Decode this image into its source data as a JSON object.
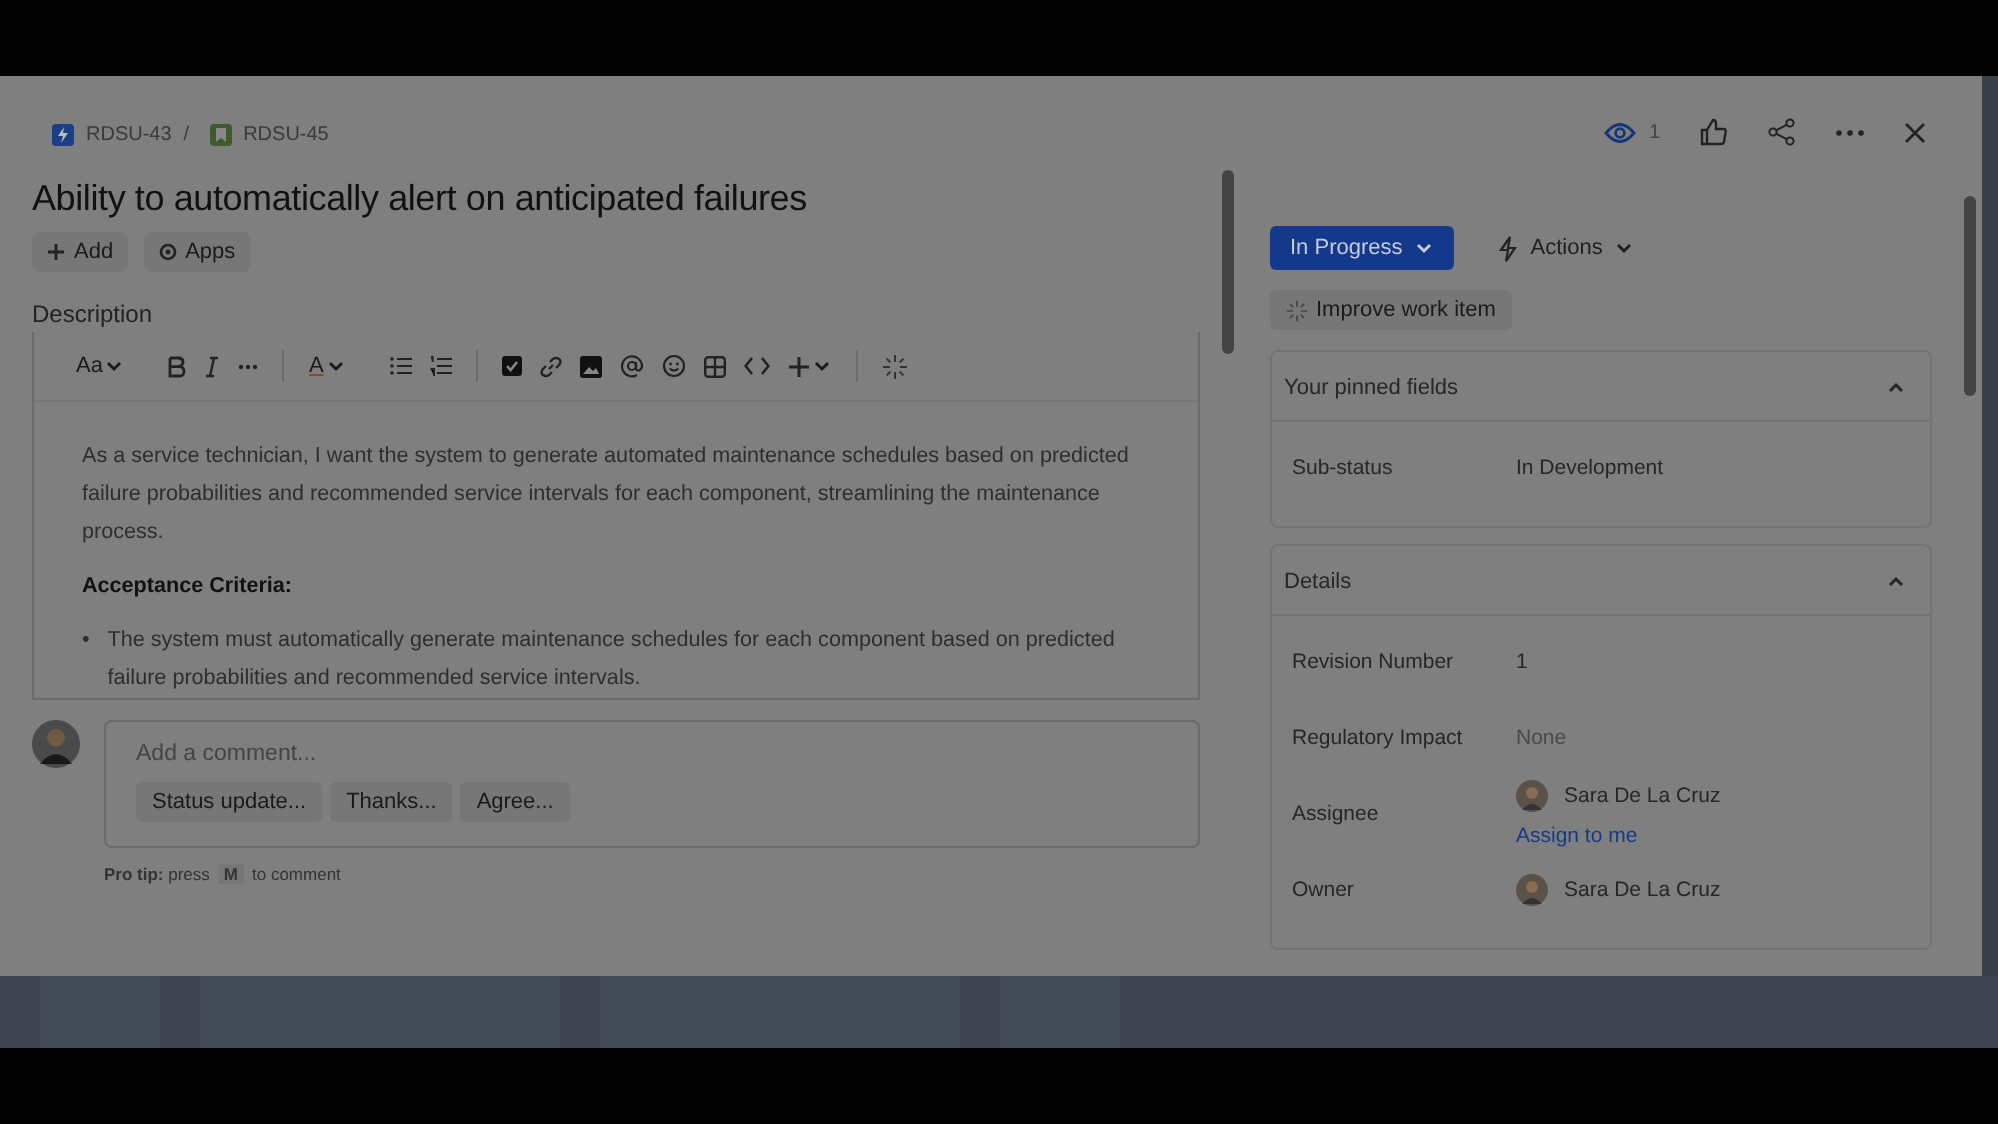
{
  "breadcrumbs": [
    {
      "label": "RDSU-43",
      "kind": "epic"
    },
    {
      "label": "RDSU-45",
      "kind": "story"
    }
  ],
  "breadcrumb_separator": "/",
  "bullet": "•",
  "header": {
    "watchers": "1"
  },
  "title": "Ability to automatically alert on anticipated failures",
  "title_actions": [
    {
      "label": "Add",
      "kind": "add"
    },
    {
      "label": "Apps",
      "kind": "apps"
    }
  ],
  "description": {
    "label": "Description",
    "toolbar": {
      "text_style": "Aa",
      "font_color_label": "A"
    },
    "paragraph": "As a service technician, I want the system to generate automated maintenance schedules based on predicted failure probabilities and recommended service intervals for each component, streamlining the maintenance process.",
    "heading": "Acceptance Criteria:",
    "bullets": [
      "The system must automatically generate maintenance schedules for each component based on predicted failure probabilities and recommended service intervals."
    ]
  },
  "comment": {
    "placeholder": "Add a comment...",
    "suggestions": [
      "Status update...",
      "Thanks...",
      "Agree..."
    ],
    "tip_prefix": "**Pro tip:** press",
    "tip_key": "M",
    "tip_suffix": "to comment"
  },
  "status": {
    "label": "In Progress"
  },
  "actions": {
    "label": "Actions"
  },
  "improve": {
    "label": "Improve work item"
  },
  "pinned": {
    "title": "Your pinned fields",
    "expanded": true,
    "fields": [
      {
        "label": "Sub-status",
        "value": "In Development",
        "kind": "text"
      }
    ]
  },
  "details": {
    "title": "Details",
    "expanded": true,
    "fields": [
      {
        "label": "Revision Number",
        "value": "1",
        "kind": "text"
      },
      {
        "label": "Regulatory Impact",
        "value": "None",
        "kind": "muted"
      },
      {
        "label": "Assignee",
        "value": "Sara De La Cruz",
        "kind": "person",
        "link": "Assign to me"
      },
      {
        "label": "Owner",
        "value": "Sara De La Cruz",
        "kind": "person"
      }
    ]
  }
}
